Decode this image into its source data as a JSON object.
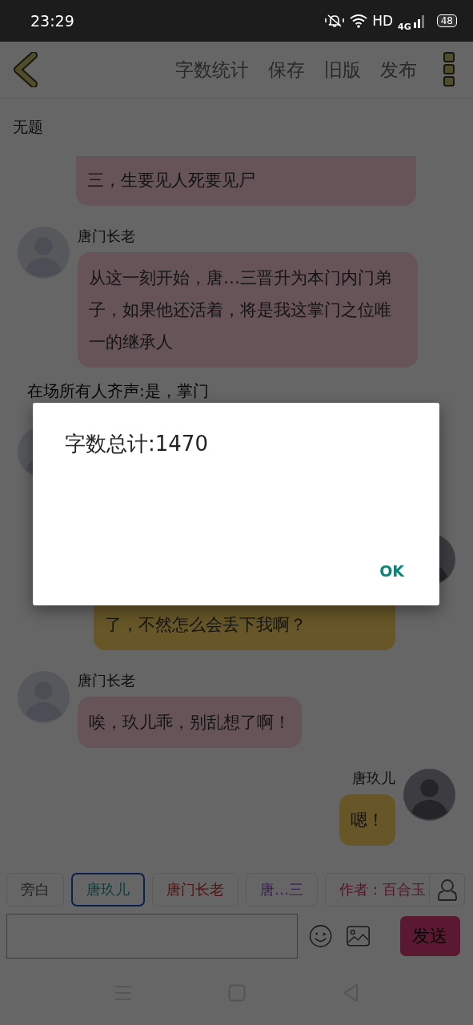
{
  "status_bar": {
    "time": "23:29",
    "network": "HD",
    "cell": "4G",
    "battery": "48"
  },
  "toolbar": {
    "actions": [
      "字数统计",
      "保存",
      "旧版",
      "发布"
    ]
  },
  "title": "无题",
  "messages": [
    {
      "kind": "left_continued",
      "color": "#665458",
      "text": "三，生要见人死要见尸"
    },
    {
      "kind": "left",
      "speaker": "唐门长老",
      "color": "#665458",
      "text": "从这一刻开始，唐…三晋升为本门内门弟子，如果他还活着，将是我这掌门之位唯一的继承人"
    },
    {
      "kind": "narration",
      "text": "在场所有人齐声:是，掌门"
    },
    {
      "kind": "left_covered"
    },
    {
      "kind": "right_covered",
      "color": "#665628",
      "text": "了，不然怎么会丢下我啊？"
    },
    {
      "kind": "left",
      "speaker": "唐门长老",
      "color": "#665458",
      "text": "唉，玖儿乖，别乱想了啊！"
    },
    {
      "kind": "right",
      "speaker": "唐玖儿",
      "color": "#665628",
      "text": "嗯！"
    }
  ],
  "characters": [
    {
      "label": "旁白",
      "color": "#222222",
      "selected": false
    },
    {
      "label": "唐玖儿",
      "color": "#0a3e38",
      "selected": true
    },
    {
      "label": "唐门长老",
      "color": "#541010",
      "selected": false
    },
    {
      "label": "唐…三",
      "color": "#382050",
      "selected": false
    },
    {
      "label": "作者：百合玉",
      "color": "#541428",
      "selected": false
    }
  ],
  "composer": {
    "send": "发送"
  },
  "dialog": {
    "message": "字数总计:1470",
    "button": "OK"
  }
}
